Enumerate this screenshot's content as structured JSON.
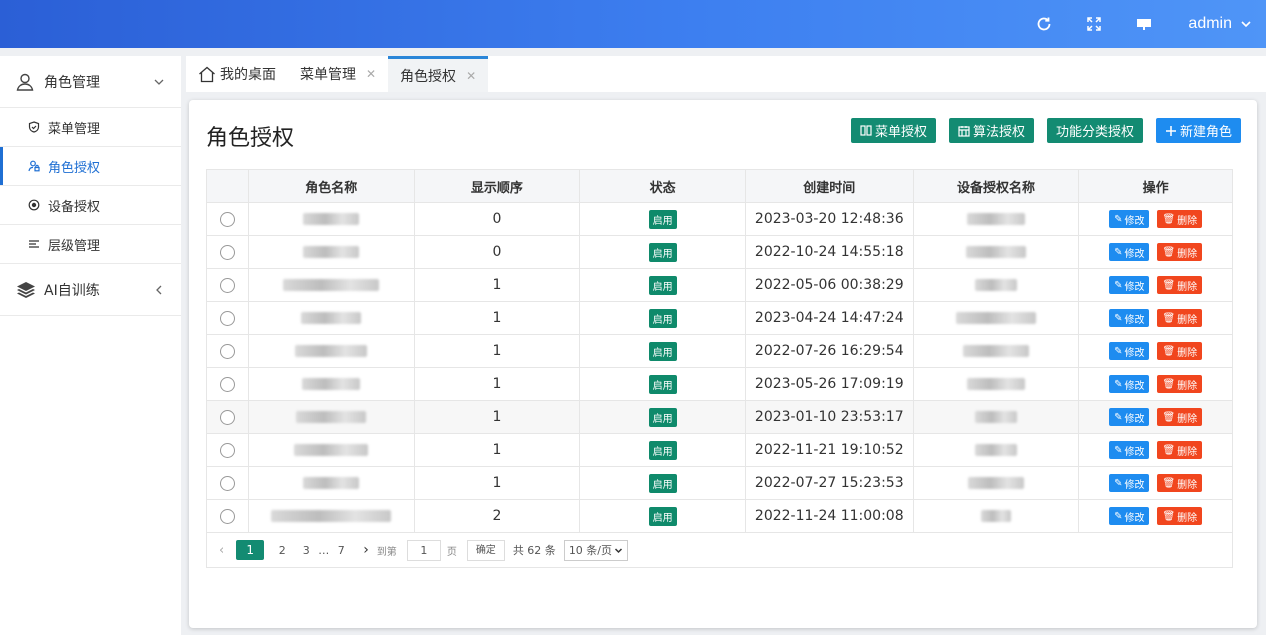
{
  "header": {
    "user": "admin"
  },
  "sidebar": {
    "groups": [
      {
        "label": "角色管理",
        "items": [
          {
            "label": "菜单管理"
          },
          {
            "label": "角色授权"
          },
          {
            "label": "设备授权"
          },
          {
            "label": "层级管理"
          }
        ]
      },
      {
        "label": "AI自训练"
      }
    ]
  },
  "tabs": [
    {
      "label": "我的桌面"
    },
    {
      "label": "菜单管理"
    },
    {
      "label": "角色授权"
    }
  ],
  "page": {
    "title": "角色授权",
    "buttons": {
      "menu_auth": "菜单授权",
      "algo_auth": "算法授权",
      "func_auth": "功能分类授权",
      "new_role": "新建角色"
    }
  },
  "table": {
    "headers": [
      "角色名称",
      "显示顺序",
      "状态",
      "创建时间",
      "设备授权名称",
      "操作"
    ],
    "status_label": "启用",
    "edit_label": "修改",
    "delete_label": "删除",
    "rows": [
      {
        "order": "0",
        "created": "2023-03-20 12:48:36"
      },
      {
        "order": "0",
        "created": "2022-10-24 14:55:18"
      },
      {
        "order": "1",
        "created": "2022-05-06 00:38:29"
      },
      {
        "order": "1",
        "created": "2023-04-24 14:47:24"
      },
      {
        "order": "1",
        "created": "2022-07-26 16:29:54"
      },
      {
        "order": "1",
        "created": "2023-05-26 17:09:19"
      },
      {
        "order": "1",
        "created": "2023-01-10 23:53:17"
      },
      {
        "order": "1",
        "created": "2022-11-21 19:10:52"
      },
      {
        "order": "1",
        "created": "2022-07-27 15:23:53"
      },
      {
        "order": "2",
        "created": "2022-11-24 11:00:08"
      }
    ]
  },
  "pagination": {
    "pages": [
      "1",
      "2",
      "3",
      "…",
      "7"
    ],
    "goto_prefix": "到第",
    "goto_value": "1",
    "goto_suffix": "页",
    "confirm": "确定",
    "total": "共 62 条",
    "page_size": "10 条/页"
  },
  "colors": {
    "accent_green": "#138b72",
    "accent_blue": "#1e8cf0",
    "danger": "#f1461e",
    "header_gradient": "#3d7ff0"
  }
}
